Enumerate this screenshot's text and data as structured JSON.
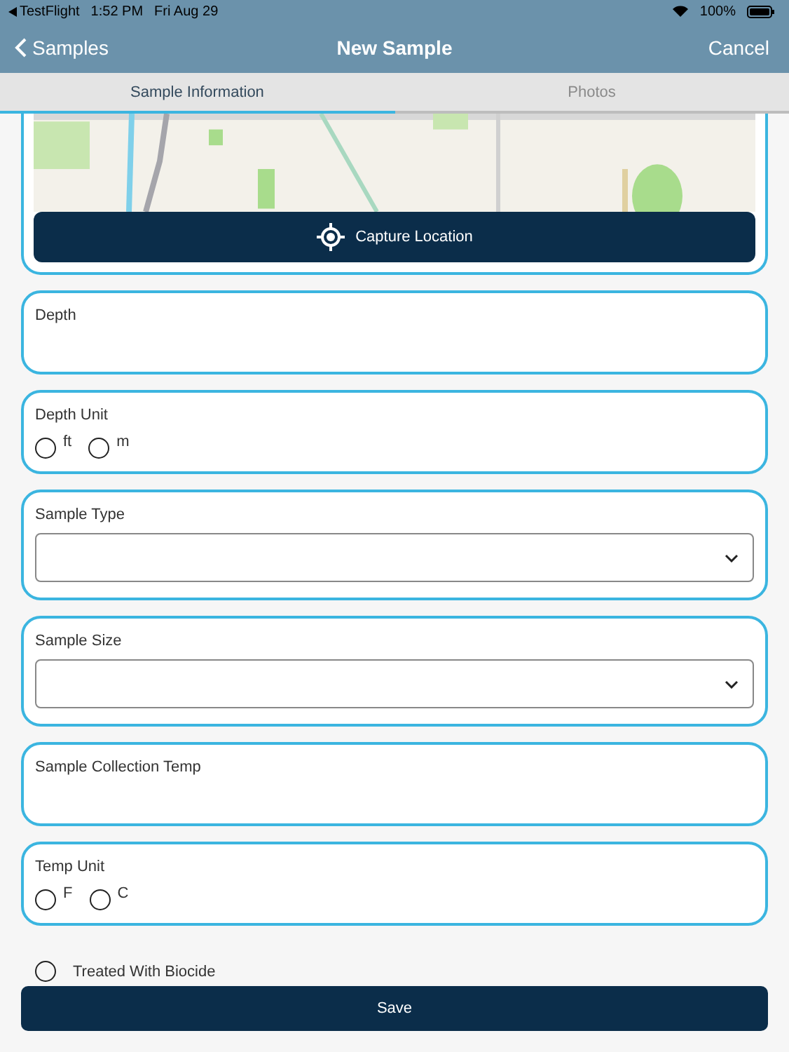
{
  "status_bar": {
    "app": "TestFlight",
    "time": "1:52 PM",
    "date": "Fri Aug 29",
    "battery": "100%"
  },
  "nav": {
    "back": "Samples",
    "title": "New Sample",
    "action": "Cancel"
  },
  "tabs": [
    {
      "label": "Sample Information",
      "selected": true
    },
    {
      "label": "Photos",
      "selected": false
    }
  ],
  "location": {
    "button": "Capture Location"
  },
  "fields": [
    {
      "kind": "text",
      "label": "Depth"
    },
    {
      "kind": "radio",
      "label": "Depth Unit",
      "options": [
        {
          "label": "ft",
          "selected": false
        },
        {
          "label": "m",
          "selected": false
        }
      ]
    },
    {
      "kind": "select",
      "label": "Sample Type"
    },
    {
      "kind": "select",
      "label": "Sample Size"
    },
    {
      "kind": "text",
      "label": "Sample Collection Temp"
    },
    {
      "kind": "radio",
      "label": "Temp Unit",
      "options": [
        {
          "label": "F",
          "selected": false
        },
        {
          "label": "C",
          "selected": false
        }
      ]
    }
  ],
  "biocide": {
    "label": "Treated With Biocide",
    "checked": false
  },
  "save": "Save"
}
